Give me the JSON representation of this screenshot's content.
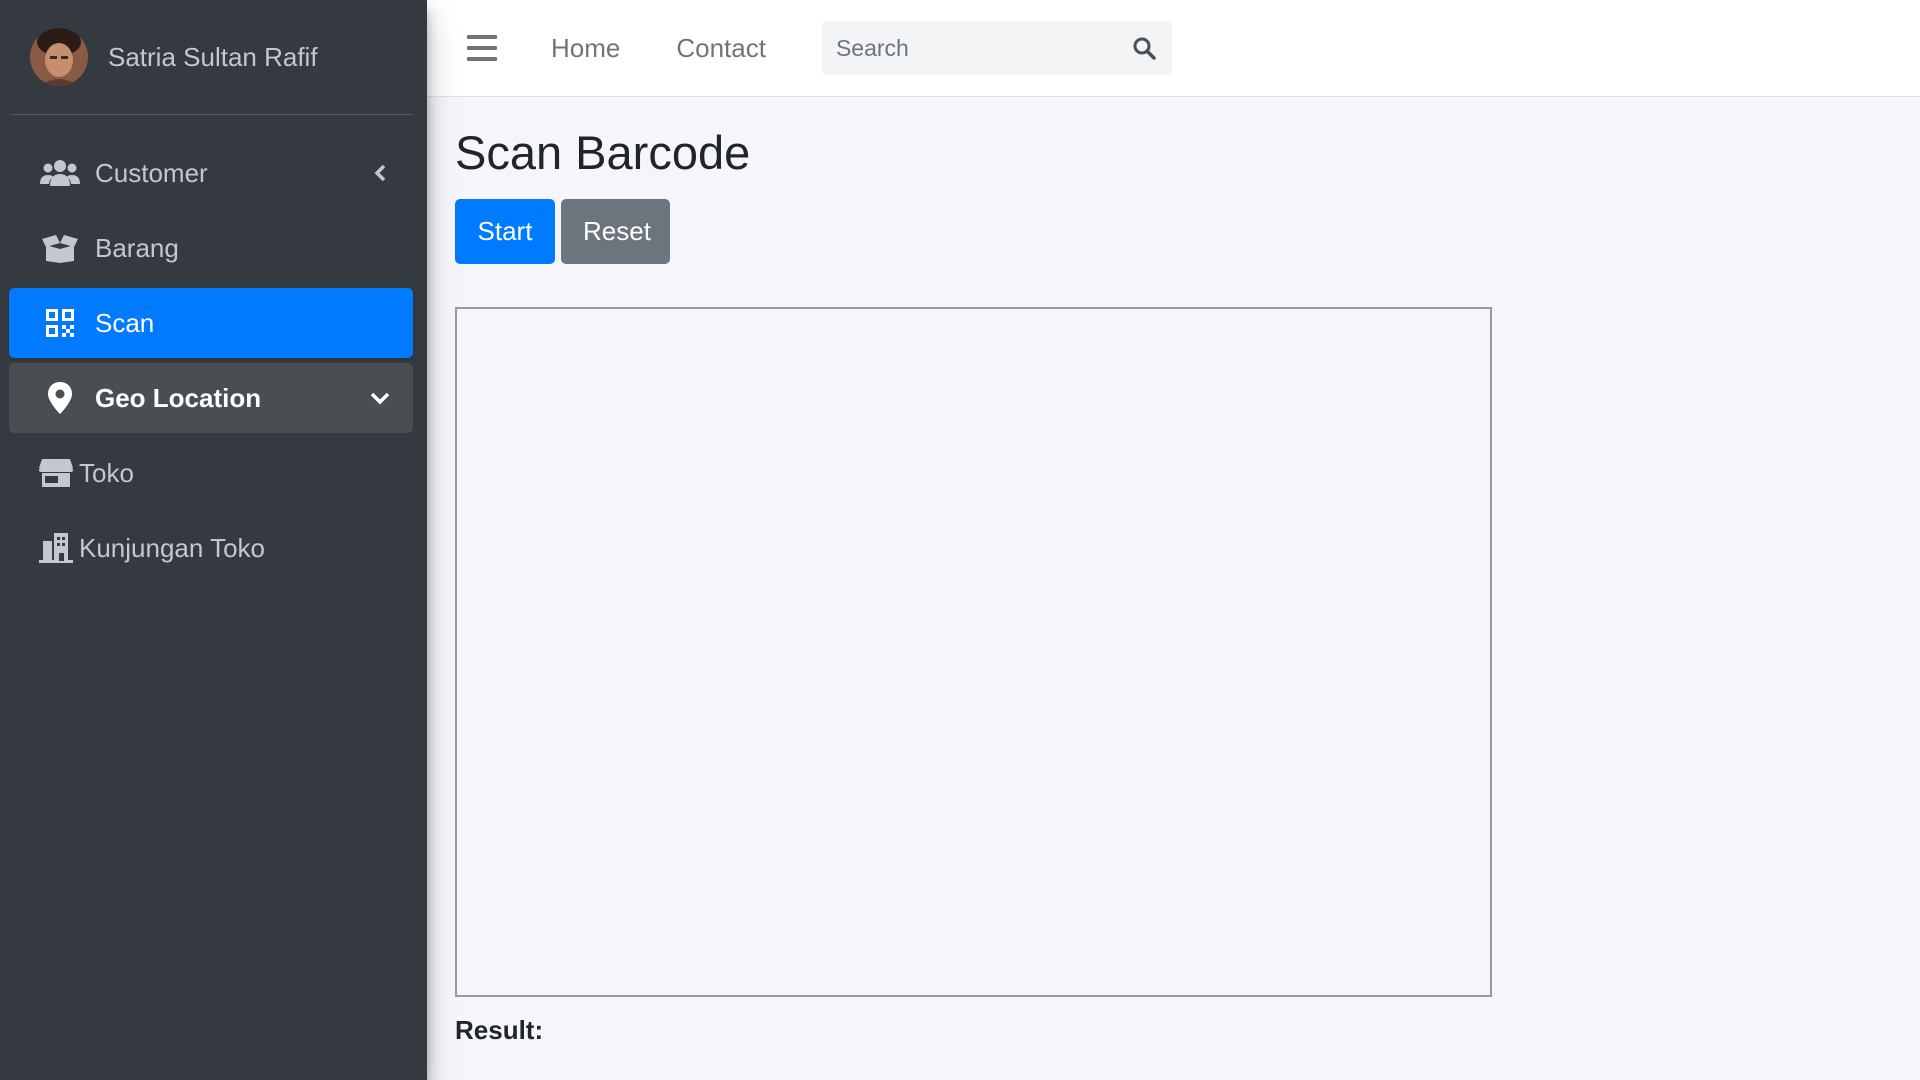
{
  "user": {
    "name": "Satria Sultan Rafif"
  },
  "sidebar": {
    "items": [
      {
        "label": "Customer",
        "icon": "users-icon",
        "caret": "chevron-left-icon"
      },
      {
        "label": "Barang",
        "icon": "box-open-icon"
      },
      {
        "label": "Scan",
        "icon": "qrcode-icon",
        "active": true
      },
      {
        "label": "Geo Location",
        "icon": "map-marker-icon",
        "caret": "chevron-down-icon",
        "open": true
      },
      {
        "label": "Toko",
        "icon": "store-icon"
      },
      {
        "label": "Kunjungan Toko",
        "icon": "building-icon"
      }
    ]
  },
  "topbar": {
    "menu_icon": "hamburger-icon",
    "links": [
      "Home",
      "Contact"
    ],
    "search": {
      "placeholder": "Search",
      "value": "",
      "icon": "search-icon"
    }
  },
  "main": {
    "title": "Scan Barcode",
    "buttons": {
      "start": "Start",
      "reset": "Reset"
    },
    "result_label": "Result:"
  },
  "colors": {
    "sidebar_bg": "#343a40",
    "primary": "#007bff",
    "secondary": "#6c757d",
    "open_item_bg": "#494e53",
    "page_bg": "#f4f6f9"
  }
}
